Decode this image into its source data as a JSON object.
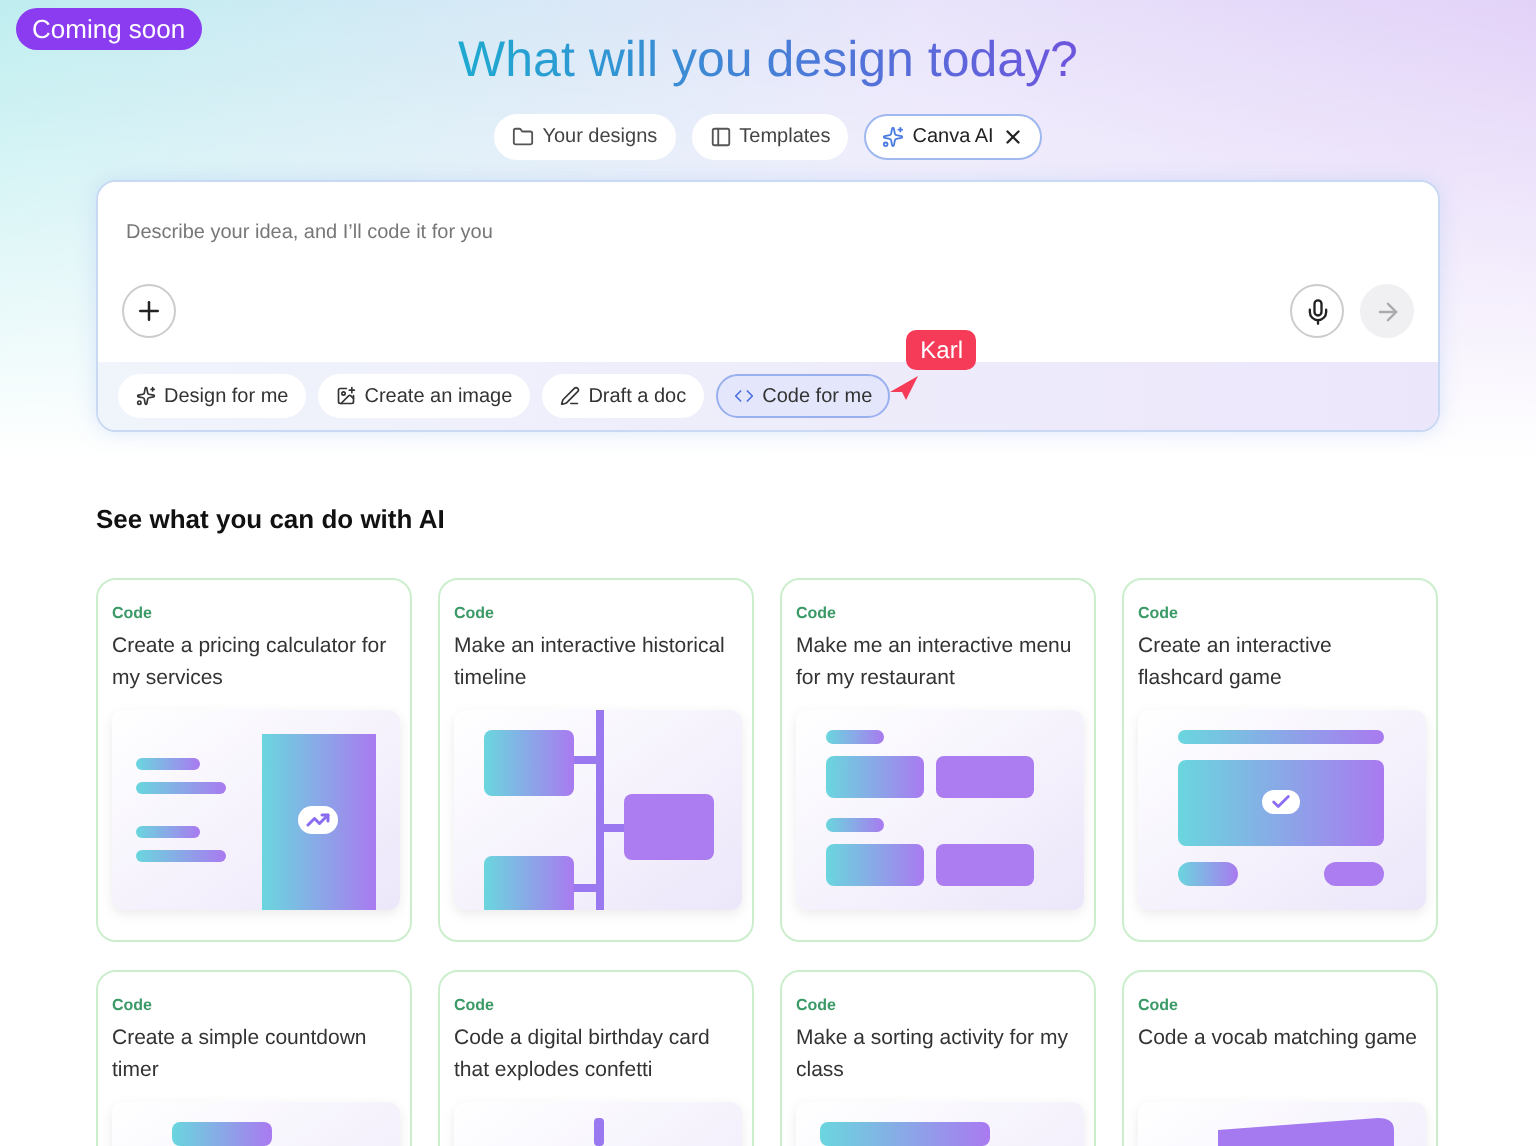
{
  "badge": "Coming soon",
  "heading": "What will you design today?",
  "tabs": [
    {
      "label": "Your designs",
      "selected": false
    },
    {
      "label": "Templates",
      "selected": false
    },
    {
      "label": "Canva AI",
      "selected": true
    }
  ],
  "prompt": {
    "placeholder": "Describe your idea, and I’ll code it for you"
  },
  "chips": [
    {
      "label": "Design for me",
      "selected": false
    },
    {
      "label": "Create an image",
      "selected": false
    },
    {
      "label": "Draft a doc",
      "selected": false
    },
    {
      "label": "Code for me",
      "selected": true
    }
  ],
  "cursor": {
    "name": "Karl"
  },
  "section_title": "See what you can do with AI",
  "cards": [
    {
      "tag": "Code",
      "text": "Create a pricing calculator for my services",
      "kind": "calculator"
    },
    {
      "tag": "Code",
      "text": "Make an interactive historical timeline",
      "kind": "timeline"
    },
    {
      "tag": "Code",
      "text": "Make me an interactive menu for my restaurant",
      "kind": "menu"
    },
    {
      "tag": "Code",
      "text": "Create an interactive flashcard game",
      "kind": "flashcard"
    },
    {
      "tag": "Code",
      "text": "Create a simple countdown timer",
      "kind": "timer"
    },
    {
      "tag": "Code",
      "text": "Code a digital birthday card that explodes confetti",
      "kind": "confetti"
    },
    {
      "tag": "Code",
      "text": "Make a sorting activity for my class",
      "kind": "sorting"
    },
    {
      "tag": "Code",
      "text": "Code a vocab matching game",
      "kind": "matching"
    }
  ]
}
